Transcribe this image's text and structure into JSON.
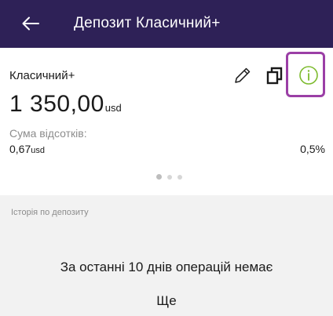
{
  "header": {
    "title": "Депозит Класичний+",
    "back_icon": "arrow-left-icon",
    "background_color": "#2e2157"
  },
  "deposit": {
    "name": "Класичний+",
    "amount": "1 350,00",
    "currency": "usd",
    "interest_label": "Сума відсотків:",
    "interest_amount": "0,67",
    "interest_currency": "usd",
    "rate": "0,5%",
    "actions": [
      {
        "name": "edit",
        "icon": "pencil-icon"
      },
      {
        "name": "copy",
        "icon": "copy-icon"
      },
      {
        "name": "info",
        "icon": "info-icon",
        "color": "#7dbb2e"
      }
    ],
    "highlight_color": "#9b3fa6",
    "pager": {
      "pages": 3,
      "active": 1
    }
  },
  "history": {
    "header": "Історія по депозиту",
    "empty_message": "За останні 10 днів операцій немає",
    "more_label": "Ще"
  }
}
